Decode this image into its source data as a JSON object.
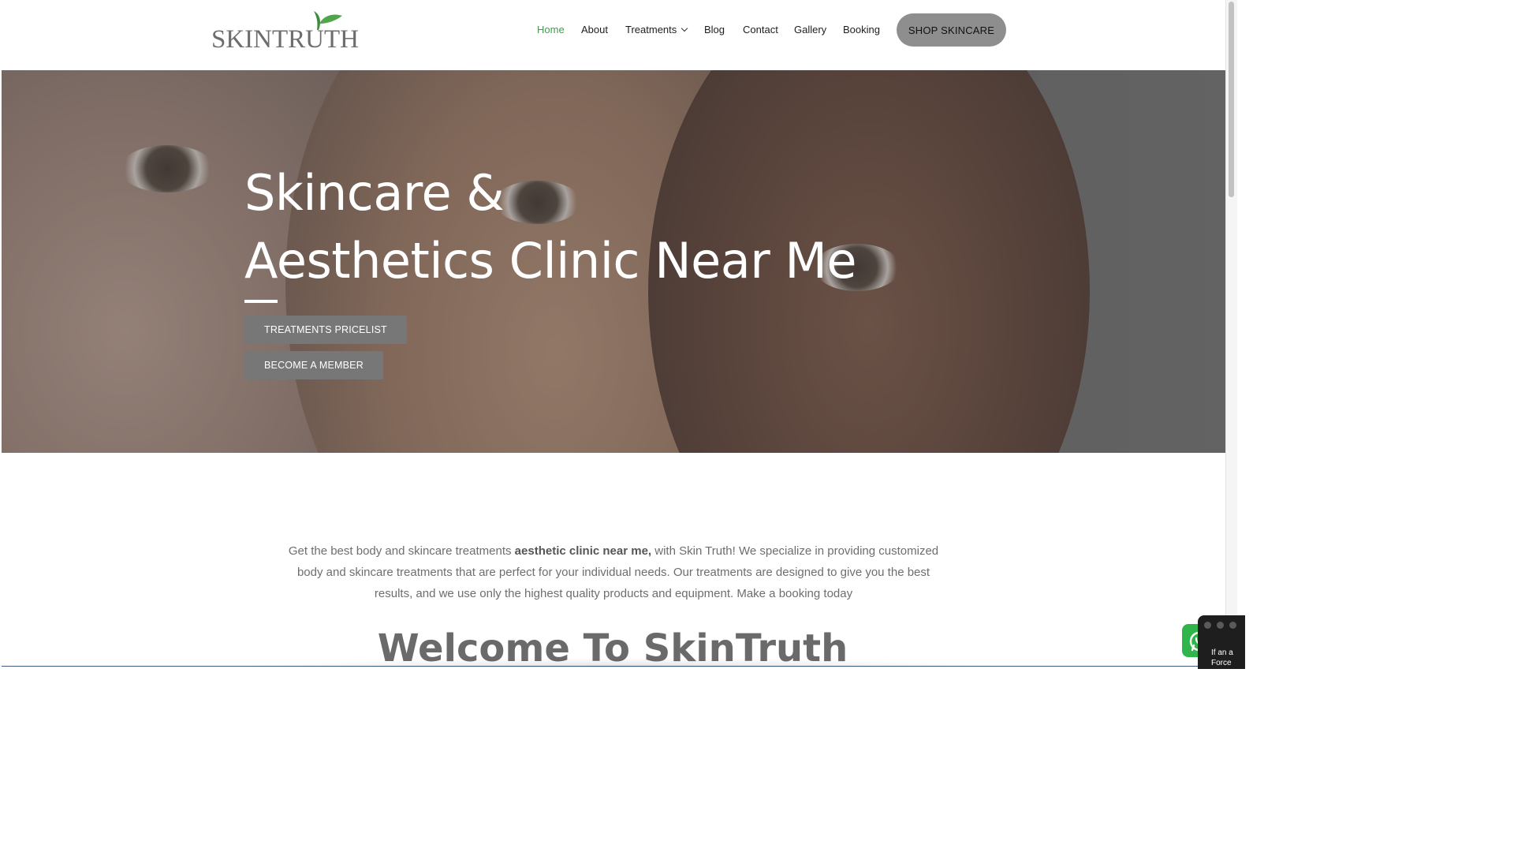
{
  "header": {
    "logo_text": "SKINTRUTH",
    "nav": [
      {
        "label": "Home",
        "active": true
      },
      {
        "label": "About"
      },
      {
        "label": "Treatments",
        "has_dropdown": true
      },
      {
        "label": "Blog"
      },
      {
        "label": "Contact"
      },
      {
        "label": "Gallery"
      },
      {
        "label": "Booking"
      }
    ],
    "shop_button": "SHOP SKINCARE"
  },
  "hero": {
    "title_line1": "Skincare &",
    "title_line2": "Aesthetics Clinic Near Me",
    "buttons": [
      "TREATMENTS PRICELIST",
      "BECOME A MEMBER"
    ]
  },
  "intro": {
    "text_before": "Get the best body and skincare treatments ",
    "text_bold": "aesthetic clinic near me,",
    "text_after": " with Skin Truth! We specialize in providing customized body and skincare treatments that are perfect for your individual needs. Our treatments are designed to give you the best results, and we use only the highest quality products and equipment. Make a booking today"
  },
  "welcome_heading": "Welcome To SkinTruth",
  "floating": {
    "whatsapp_icon": "whatsapp-icon",
    "mini_window_text_line1": "If an a",
    "mini_window_text_line2": "Force"
  },
  "colors": {
    "nav_active": "#3e9e4d",
    "shop_button_bg": "#8e8e8e",
    "hero_button_bg": "#777777",
    "whatsapp_green": "#2fb54a"
  }
}
